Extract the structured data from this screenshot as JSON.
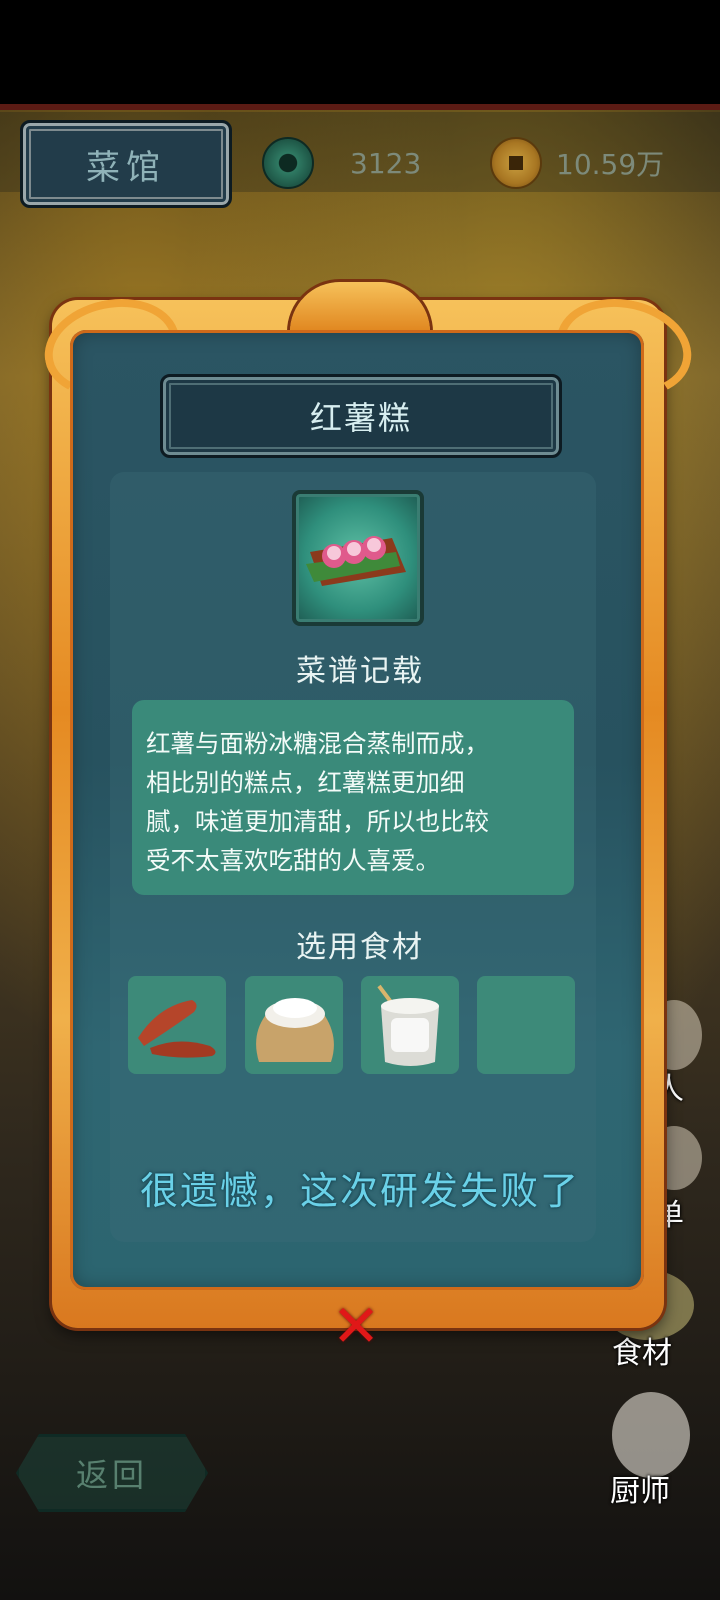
{
  "header": {
    "title": "菜馆",
    "jade_value": "3123",
    "coin_value": "10.59万"
  },
  "side_buttons": [
    {
      "label": "人",
      "icon": "guest-portrait-icon"
    },
    {
      "label": "单",
      "icon": "menu-dishes-icon"
    },
    {
      "label": "食材",
      "icon": "vegetables-basket-icon"
    },
    {
      "label": "厨师",
      "icon": "chef-portrait-icon"
    }
  ],
  "modal": {
    "dish_name": "红薯糕",
    "recipe_heading": "菜谱记载",
    "description_lines": [
      "红薯与面粉冰糖混合蒸制而成，",
      "相比别的糕点，红薯糕更加细",
      "腻，味道更加清甜，所以也比较",
      "受不太喜欢吃甜的人喜爱。"
    ],
    "ingredients_heading": "选用食材",
    "ingredients": [
      {
        "name": "sweet-potato-icon"
      },
      {
        "name": "flour-sack-icon"
      },
      {
        "name": "rock-sugar-jar-icon"
      },
      {
        "name": ""
      }
    ],
    "result_text": "很遗憾，这次研发失败了",
    "close_label": "✕"
  },
  "footer": {
    "back_label": "返回"
  },
  "colors": {
    "frame_orange": "#e58a22",
    "panel_teal": "#27525f",
    "fail_text": "#6ad1e8",
    "close_red": "#e01818"
  }
}
